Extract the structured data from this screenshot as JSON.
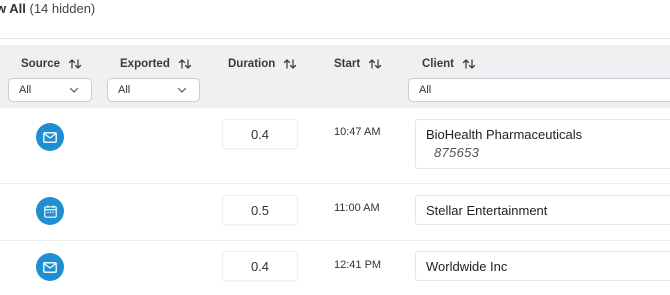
{
  "toolbar": {
    "view_all_prefix": "w All",
    "view_all_hidden": "(14 hidden)"
  },
  "columns": [
    {
      "label": "Source"
    },
    {
      "label": "Exported"
    },
    {
      "label": "Duration"
    },
    {
      "label": "Start"
    },
    {
      "label": "Client"
    }
  ],
  "filters": {
    "source": "All",
    "exported": "All",
    "client": "All"
  },
  "rows": [
    {
      "source_icon": "mail-icon",
      "duration": "0.4",
      "start": "10:47 AM",
      "client": "BioHealth Pharmaceuticals",
      "client_sub": "875653"
    },
    {
      "source_icon": "calendar-icon",
      "duration": "0.5",
      "start": "11:00 AM",
      "client": "Stellar Entertainment",
      "client_sub": ""
    },
    {
      "source_icon": "mail-icon",
      "duration": "0.4",
      "start": "12:41 PM",
      "client": "Worldwide Inc",
      "client_sub": ""
    }
  ],
  "colors": {
    "accent": "#1f8fd1",
    "header_band": "#eef0f2"
  }
}
